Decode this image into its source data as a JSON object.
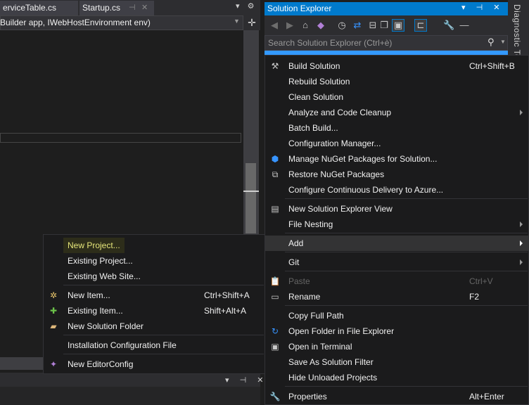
{
  "editor": {
    "tabs": [
      {
        "label": "erviceTable.cs"
      },
      {
        "label": "Startup.cs",
        "pin_glyph": "⊣",
        "close_glyph": "✕"
      }
    ],
    "tab_controls": "▾ ⚙",
    "navbar_text": "Builder app, IWebHostEnvironment env)",
    "split_glyph": "✛",
    "bottom_controls": "▾ ⊣ ✕"
  },
  "solution_explorer": {
    "title": "Solution Explorer",
    "title_controls": "▾ ⊣ ✕",
    "search_placeholder": "Search Solution Explorer (Ctrl+è)",
    "side_tab": "Diagnostic Tools",
    "toolbar_icons": [
      "back-icon",
      "forward-icon",
      "home-icon",
      "vs-icon",
      "history-icon",
      "sync-icon",
      "collapse-icon",
      "show-files-icon",
      "active-doc-icon",
      "preview-icon",
      "properties-icon",
      "dash-icon"
    ]
  },
  "context_menu": {
    "items": [
      {
        "label": "Build Solution",
        "shortcut": "Ctrl+Shift+B",
        "icon": "build-icon"
      },
      {
        "label": "Rebuild Solution"
      },
      {
        "label": "Clean Solution"
      },
      {
        "label": "Analyze and Code Cleanup",
        "submenu": true
      },
      {
        "label": "Batch Build..."
      },
      {
        "label": "Configuration Manager..."
      },
      {
        "label": "Manage NuGet Packages for Solution...",
        "icon": "nuget-icon"
      },
      {
        "label": "Restore NuGet Packages",
        "icon": "restore-icon"
      },
      {
        "label": "Configure Continuous Delivery to Azure..."
      },
      {
        "label": "New Solution Explorer View",
        "icon": "new-view-icon"
      },
      {
        "label": "File Nesting",
        "submenu": true
      },
      {
        "label": "Add",
        "submenu": true,
        "highlighted": true
      },
      {
        "label": "Git",
        "submenu": true
      },
      {
        "label": "Paste",
        "shortcut": "Ctrl+V",
        "disabled": true,
        "icon": "paste-icon"
      },
      {
        "label": "Rename",
        "shortcut": "F2",
        "icon": "rename-icon"
      },
      {
        "label": "Copy Full Path"
      },
      {
        "label": "Open Folder in File Explorer",
        "icon": "open-folder-icon"
      },
      {
        "label": "Open in Terminal",
        "icon": "terminal-icon"
      },
      {
        "label": "Save As Solution Filter"
      },
      {
        "label": "Hide Unloaded Projects"
      },
      {
        "label": "Properties",
        "shortcut": "Alt+Enter",
        "icon": "wrench-icon"
      }
    ]
  },
  "add_submenu": {
    "items": [
      {
        "label": "New Project..."
      },
      {
        "label": "Existing Project..."
      },
      {
        "label": "Existing Web Site..."
      },
      {
        "label": "New Item...",
        "shortcut": "Ctrl+Shift+A",
        "icon": "new-item-icon"
      },
      {
        "label": "Existing Item...",
        "shortcut": "Shift+Alt+A",
        "icon": "existing-item-icon"
      },
      {
        "label": "New Solution Folder",
        "icon": "folder-icon"
      },
      {
        "label": "Installation Configuration File"
      },
      {
        "label": "New EditorConfig",
        "icon": "editorconfig-icon"
      }
    ]
  },
  "colors": {
    "accent": "#007acc",
    "menu_bg": "#1b1b1c",
    "hover_bg": "#333334",
    "first_item_fg": "#e6e67a"
  }
}
